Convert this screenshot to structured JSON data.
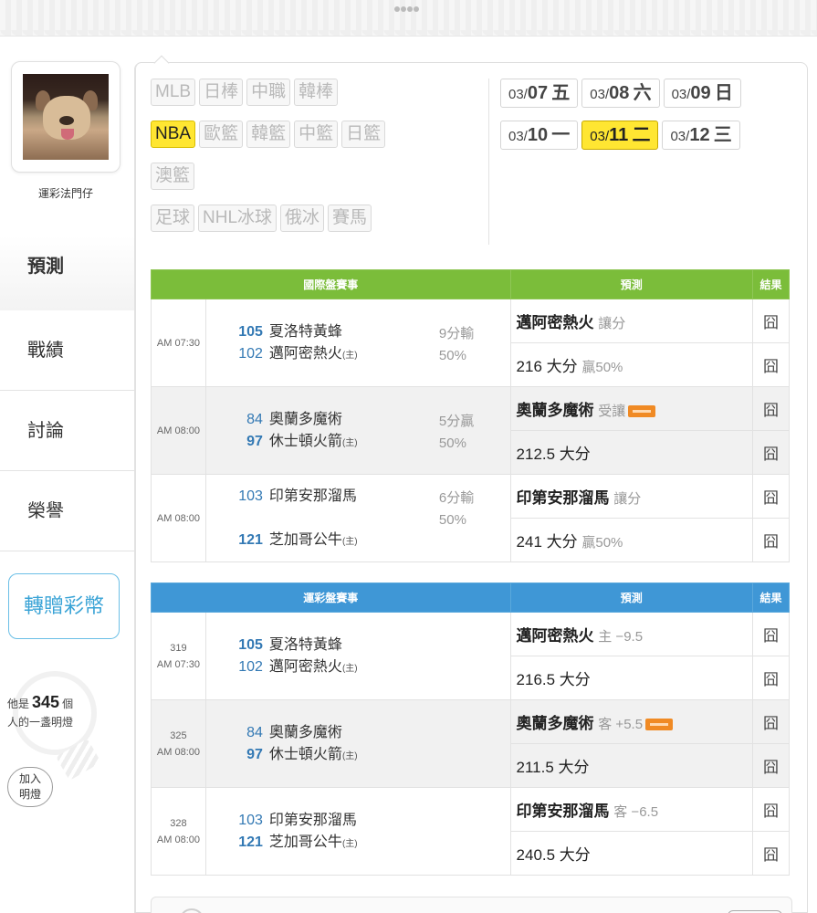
{
  "user": {
    "name": "運彩法門仔"
  },
  "nav": {
    "items": [
      {
        "label": "預測"
      },
      {
        "label": "戰績"
      },
      {
        "label": "討論"
      },
      {
        "label": "榮譽"
      }
    ],
    "gift_label": "轉贈彩幣"
  },
  "lamp": {
    "prefix": "他是",
    "count": "345",
    "suffix": "個",
    "line2": "人的一盞明燈",
    "join_line1": "加入",
    "join_line2": "明燈"
  },
  "sports": {
    "row1": [
      "MLB",
      "日棒",
      "中職",
      "韓棒"
    ],
    "row2": [
      "NBA",
      "歐籃",
      "韓籃",
      "中籃",
      "日籃"
    ],
    "row3": [
      "澳籃"
    ],
    "row4": [
      "足球",
      "NHL冰球",
      "俄冰",
      "賽馬"
    ],
    "active": "NBA"
  },
  "dates": [
    {
      "md": "03/",
      "day": "07",
      "wd": "五"
    },
    {
      "md": "03/",
      "day": "08",
      "wd": "六"
    },
    {
      "md": "03/",
      "day": "09",
      "wd": "日"
    },
    {
      "md": "03/",
      "day": "10",
      "wd": "一"
    },
    {
      "md": "03/",
      "day": "11",
      "wd": "二",
      "active": true
    },
    {
      "md": "03/",
      "day": "12",
      "wd": "三"
    }
  ],
  "intl_table": {
    "header_event": "國際盤賽事",
    "header_pred": "預測",
    "header_result": "結果",
    "games": [
      {
        "time": "AM 07:30",
        "away_num": "105",
        "away": "夏洛特黃蜂",
        "home_num": "102",
        "home": "邁阿密熱火",
        "home_mark": "(主)",
        "spread": "9分輸",
        "pct": "50%",
        "pred1": "邁阿密熱火",
        "pred1_sub": "讓分",
        "pred2": "216 大分",
        "pred2_sub": "贏50%",
        "res1": "囧",
        "res2": "囧"
      },
      {
        "time": "AM 08:00",
        "away_num": "84",
        "away": "奧蘭多魔術",
        "home_num": "97",
        "home": "休士頓火箭",
        "home_mark": "(主)",
        "spread": "5分贏",
        "pct": "50%",
        "pred1": "奧蘭多魔術",
        "pred1_sub": "受讓",
        "pred2": "212.5 大分",
        "pred2_sub": "",
        "res1": "囧",
        "res2": "囧"
      },
      {
        "time": "AM 08:00",
        "away_num": "103",
        "away": "印第安那溜馬",
        "home_num": "121",
        "home": "芝加哥公牛",
        "home_mark": "(主)",
        "spread": "6分輸",
        "pct": "50%",
        "pred1": "印第安那溜馬",
        "pred1_sub": "讓分",
        "pred2": "241 大分",
        "pred2_sub": "贏50%",
        "res1": "囧",
        "res2": "囧"
      }
    ]
  },
  "lottery_table": {
    "header_event": "運彩盤賽事",
    "header_pred": "預測",
    "header_result": "結果",
    "games": [
      {
        "id": "319",
        "time": "AM 07:30",
        "away_num": "105",
        "away": "夏洛特黃蜂",
        "home_num": "102",
        "home": "邁阿密熱火",
        "home_mark": "(主)",
        "pred1": "邁阿密熱火",
        "pred1_sub": "主 −9.5",
        "pred2": "216.5 大分",
        "res1": "囧",
        "res2": "囧"
      },
      {
        "id": "325",
        "time": "AM 08:00",
        "away_num": "84",
        "away": "奧蘭多魔術",
        "home_num": "97",
        "home": "休士頓火箭",
        "home_mark": "(主)",
        "pred1": "奧蘭多魔術",
        "pred1_sub": "客 +5.5",
        "pred2": "211.5 大分",
        "res1": "囧",
        "res2": "囧"
      },
      {
        "id": "328",
        "time": "AM 08:00",
        "away_num": "103",
        "away": "印第安那溜馬",
        "home_num": "121",
        "home": "芝加哥公牛",
        "home_mark": "(主)",
        "pred1": "印第安那溜馬",
        "pred1_sub": "客 −6.5",
        "pred2": "240.5 大分",
        "res1": "囧",
        "res2": "囧"
      }
    ]
  },
  "colors": {
    "intl_header": "#7bbd3a",
    "lottery_header": "#3f97d6",
    "active_tag": "#ffe632",
    "team_num": "#3379b4",
    "gift": "#39a3d6"
  }
}
